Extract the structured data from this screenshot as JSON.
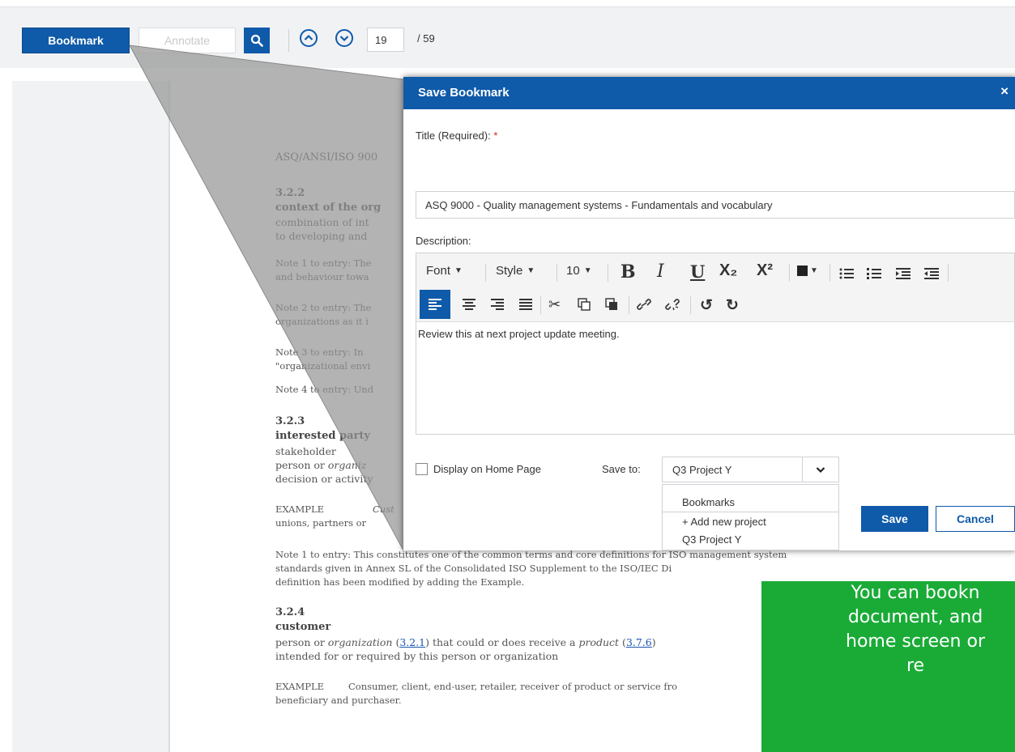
{
  "toolbar": {
    "bookmark_label": "Bookmark",
    "annotate_label": "Annotate",
    "page_current": "19",
    "page_total": "/ 59",
    "icons": [
      "search-icon",
      "chevron-up-icon",
      "chevron-down-icon"
    ]
  },
  "document": {
    "header": "ASQ/ANSI/ISO 900",
    "s322_num": "3.2.2",
    "s322_term": "context of the org",
    "s322_l1": "combination of int",
    "s322_l2": "to developing and",
    "note1_l1": "Note 1 to entry: The",
    "note1_l2": "and behaviour towa",
    "note2_l1": "Note 2 to entry: The",
    "note2_l2": "organizations as it i",
    "note3_l1": "Note 3 to entry: In",
    "note3_l2": "\"organizational envi",
    "note4": "Note 4 to entry: Und",
    "s323_num": "3.2.3",
    "s323_term": "interested party",
    "s323_l1": "stakeholder",
    "s323_l2a": "person or ",
    "s323_l2b": "organiz",
    "s323_l3": "decision or activity",
    "ex1_label": "EXAMPLE",
    "ex1_text": "Cust",
    "ex1_l2": "unions, partners or",
    "n1_l1": "Note 1 to entry: This constitutes one of the common terms and core definitions for ISO management system",
    "n1_l2": "standards given in Annex SL of the Consolidated ISO Supplement to the ISO/IEC Di",
    "n1_l3": "definition has been modified by adding the Example.",
    "s324_num": "3.2.4",
    "s324_term": "customer",
    "s324_l1a": "person or ",
    "s324_l1b": "organization",
    "s324_l1c": " (",
    "s324_ref1": "3.2.1",
    "s324_l1d": ") that could or does receive a ",
    "s324_l1e": "product",
    "s324_l1f": " (",
    "s324_ref2": "3.7.6",
    "s324_l1g": ")",
    "s324_l2": "intended for or required by this person or organization",
    "ex2_label": "EXAMPLE",
    "ex2_text": "Consumer, client, end-user, retailer, receiver of product or service fro",
    "ex2_l2": "beneficiary and purchaser."
  },
  "modal": {
    "title": "Save Bookmark",
    "close": "×",
    "title_label": "Title (Required):",
    "required_mark": "*",
    "title_value": "ASQ 9000 - Quality management systems - Fundamentals and vocabulary",
    "description_label": "Description:",
    "editor": {
      "font": "Font",
      "style": "Style",
      "size": "10",
      "bold": "B",
      "italic": "I",
      "underline": "U",
      "subscript": "X₂",
      "superscript": "X²",
      "body": "Review this at next project update meeting."
    },
    "display_home_label": "Display on Home Page",
    "display_home_checked": false,
    "save_to_label": "Save to:",
    "save_to_value": "Q3 Project Y",
    "options": [
      "Bookmarks",
      "+ Add new project",
      "Q3 Project Y"
    ],
    "save_label": "Save",
    "cancel_label": "Cancel"
  },
  "callout": {
    "line1": "You can bookn",
    "line2": "document, and",
    "line3": "home screen or",
    "line4": "re",
    "color": "#1aab37"
  }
}
